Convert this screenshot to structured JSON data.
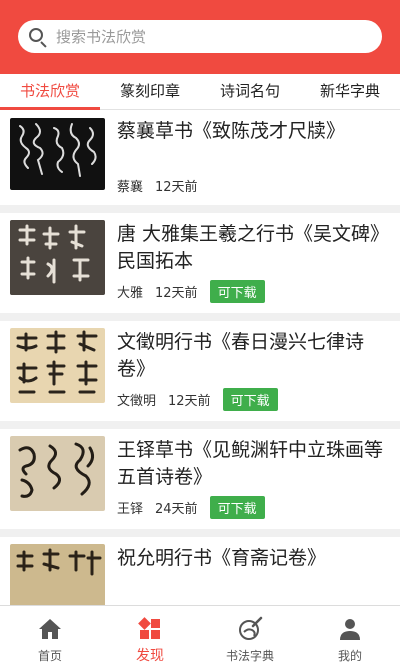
{
  "search": {
    "placeholder": "搜索书法欣赏"
  },
  "tabs": [
    {
      "label": "书法欣赏",
      "active": true
    },
    {
      "label": "篆刻印章",
      "active": false
    },
    {
      "label": "诗词名句",
      "active": false
    },
    {
      "label": "新华字典",
      "active": false
    }
  ],
  "items": [
    {
      "title": "蔡襄草书《致陈茂才尺牍》",
      "author": "蔡襄",
      "date": "12天前",
      "badge": ""
    },
    {
      "title": "唐 大雅集王羲之行书《吴文碑》民国拓本",
      "author": "大雅",
      "date": "12天前",
      "badge": "可下载"
    },
    {
      "title": "文徵明行书《春日漫兴七律诗卷》",
      "author": "文徵明",
      "date": "12天前",
      "badge": "可下载"
    },
    {
      "title": "王铎草书《见鲵渊轩中立珠画等五首诗卷》",
      "author": "王铎",
      "date": "24天前",
      "badge": "可下载"
    },
    {
      "title": "祝允明行书《育斋记卷》",
      "author": "",
      "date": "",
      "badge": ""
    }
  ],
  "nav": [
    {
      "label": "首页",
      "icon": "home-icon",
      "active": false
    },
    {
      "label": "发现",
      "icon": "discover-icon",
      "active": true
    },
    {
      "label": "书法字典",
      "icon": "brush-icon",
      "active": false
    },
    {
      "label": "我的",
      "icon": "user-icon",
      "active": false
    }
  ],
  "colors": {
    "accent": "#f04a40",
    "download": "#3fae4b"
  }
}
